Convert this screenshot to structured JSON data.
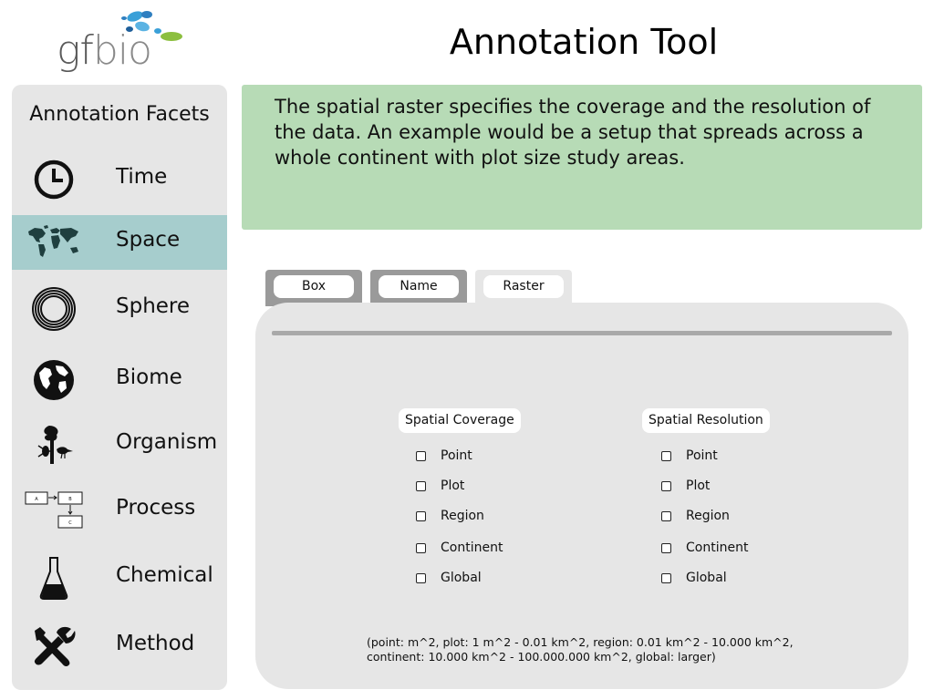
{
  "header": {
    "logo_text_gf": "gf",
    "logo_text_bio": "bio",
    "title": "Annotation Tool"
  },
  "sidebar": {
    "title": "Annotation Facets",
    "items": [
      {
        "label": "Time",
        "icon": "clock-icon"
      },
      {
        "label": "Space",
        "icon": "world-map-icon",
        "active": true
      },
      {
        "label": "Sphere",
        "icon": "concentric-circles-icon"
      },
      {
        "label": "Biome",
        "icon": "globe-icon"
      },
      {
        "label": "Organism",
        "icon": "organism-icon"
      },
      {
        "label": "Process",
        "icon": "process-diagram-icon"
      },
      {
        "label": "Chemical",
        "icon": "flask-icon"
      },
      {
        "label": "Method",
        "icon": "tools-icon"
      }
    ],
    "process_icon_letters": [
      "A",
      "B",
      "C"
    ]
  },
  "description": "The spatial raster specifies the coverage and the resolution of the data. An example would be a setup that spreads across a whole continent with plot size study areas.",
  "tabs": [
    {
      "label": "Box",
      "active": false
    },
    {
      "label": "Name",
      "active": false
    },
    {
      "label": "Raster",
      "active": true
    }
  ],
  "coverage": {
    "label": "Spatial Coverage",
    "options": [
      "Point",
      "Plot",
      "Region",
      "Continent",
      "Global"
    ]
  },
  "resolution": {
    "label": "Spatial Resolution",
    "options": [
      "Point",
      "Plot",
      "Region",
      "Continent",
      "Global"
    ]
  },
  "footnote": "(point: m^2,  plot: 1 m^2 - 0.01 km^2, region: 0.01 km^2 - 10.000 km^2, continent: 10.000 km^2 - 100.000.000 km^2, global: larger)",
  "colors": {
    "active_facet": "#a6cdcd",
    "description_bg": "#b7dbb6",
    "panel_bg": "#e6e6e6",
    "inactive_tab": "#9a9a9a",
    "logo_blue": "#3aa0d8",
    "logo_green": "#8cbf3f"
  }
}
